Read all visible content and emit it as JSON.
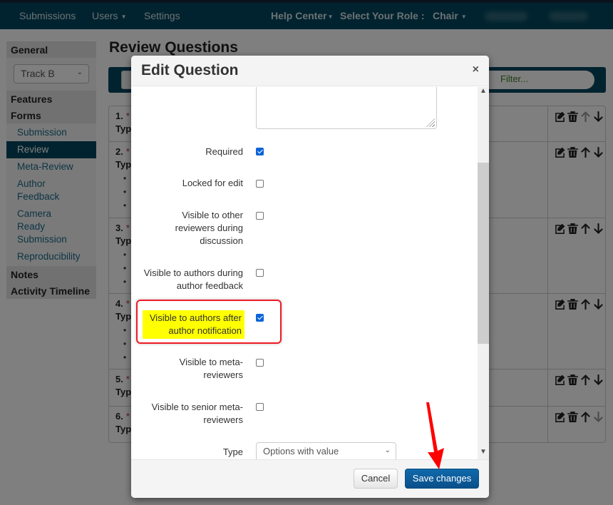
{
  "navbar": {
    "items": [
      "Submissions",
      "Users",
      "Settings"
    ],
    "help_center": "Help Center",
    "role_label": "Select Your Role :",
    "role_value": "Chair"
  },
  "sidebar": {
    "general": "General",
    "track_select": "Track B",
    "features": "Features",
    "forms": "Forms",
    "form_links": [
      "Submission",
      "Review",
      "Meta-Review",
      "Author Feedback",
      "Camera Ready Submission",
      "Reproducibility"
    ],
    "active_link": "Review",
    "notes": "Notes",
    "activity_timeline": "Activity Timeline"
  },
  "page": {
    "title": "Review Questions",
    "filter_placeholder": "Filter..."
  },
  "questions": [
    {
      "num": "1.",
      "type_label": "Typ"
    },
    {
      "num": "2.",
      "type_label": "Typ"
    },
    {
      "num": "3.",
      "type_label": "Typ"
    },
    {
      "num": "4.",
      "type_label": "Typ"
    },
    {
      "num": "5.",
      "type_label": "Typ"
    },
    {
      "num": "6.",
      "type_label": "Typ"
    }
  ],
  "modal": {
    "title": "Edit Question",
    "close": "×",
    "fields": {
      "required": {
        "label": "Required",
        "checked": true
      },
      "locked": {
        "label": "Locked for edit",
        "checked": false
      },
      "visible_reviewers": {
        "label_lines": [
          "Visible to other",
          "reviewers during",
          "discussion"
        ],
        "checked": false
      },
      "visible_authors_feedback": {
        "label_lines": [
          "Visible to authors during",
          "author feedback"
        ],
        "checked": false
      },
      "visible_authors_notification": {
        "label_lines": [
          "Visible to authors after",
          "author notification"
        ],
        "checked": true
      },
      "visible_meta": {
        "label_lines": [
          "Visible to meta-",
          "reviewers"
        ],
        "checked": false
      },
      "visible_senior_meta": {
        "label_lines": [
          "Visible to senior meta-",
          "reviewers"
        ],
        "checked": false
      },
      "type": {
        "label": "Type",
        "value": "Options with value"
      }
    },
    "cancel": "Cancel",
    "save": "Save changes"
  },
  "colors": {
    "navbar": "#00475e",
    "accent_link": "#1b6b8a",
    "primary_button": "#0a5a96",
    "highlight": "#ffff00",
    "annotation": "#ee1c25"
  }
}
